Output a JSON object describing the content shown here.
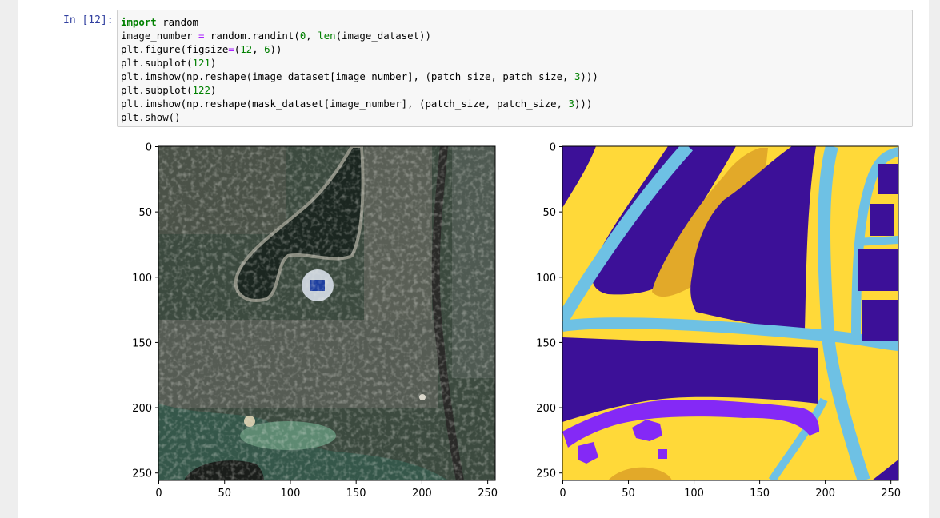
{
  "cell": {
    "prompt": "In [12]:",
    "code_lines": [
      [
        {
          "t": "import",
          "c": "kw"
        },
        {
          "t": " random",
          "c": ""
        }
      ],
      [
        {
          "t": "image_number ",
          "c": ""
        },
        {
          "t": "=",
          "c": "op"
        },
        {
          "t": " random.randint(",
          "c": ""
        },
        {
          "t": "0",
          "c": "num"
        },
        {
          "t": ", ",
          "c": ""
        },
        {
          "t": "len",
          "c": "bi"
        },
        {
          "t": "(image_dataset))",
          "c": ""
        }
      ],
      [
        {
          "t": "plt.figure(figsize",
          "c": ""
        },
        {
          "t": "=",
          "c": "op"
        },
        {
          "t": "(",
          "c": ""
        },
        {
          "t": "12",
          "c": "num"
        },
        {
          "t": ", ",
          "c": ""
        },
        {
          "t": "6",
          "c": "num"
        },
        {
          "t": "))",
          "c": ""
        }
      ],
      [
        {
          "t": "plt.subplot(",
          "c": ""
        },
        {
          "t": "121",
          "c": "num"
        },
        {
          "t": ")",
          "c": ""
        }
      ],
      [
        {
          "t": "plt.imshow(np.reshape(image_dataset[image_number], (patch_size, patch_size, ",
          "c": ""
        },
        {
          "t": "3",
          "c": "num"
        },
        {
          "t": ")))",
          "c": ""
        }
      ],
      [
        {
          "t": "plt.subplot(",
          "c": ""
        },
        {
          "t": "122",
          "c": "num"
        },
        {
          "t": ")",
          "c": ""
        }
      ],
      [
        {
          "t": "plt.imshow(np.reshape(mask_dataset[image_number], (patch_size, patch_size, ",
          "c": ""
        },
        {
          "t": "3",
          "c": "num"
        },
        {
          "t": ")))",
          "c": ""
        }
      ],
      [
        {
          "t": "plt.show()",
          "c": ""
        }
      ]
    ]
  },
  "plots": [
    {
      "kind": "satellite-image",
      "xticks": [
        "0",
        "50",
        "100",
        "150",
        "200",
        "250"
      ],
      "yticks": [
        "0",
        "50",
        "100",
        "150",
        "200",
        "250"
      ]
    },
    {
      "kind": "segmentation-mask",
      "xticks": [
        "0",
        "50",
        "100",
        "150",
        "200",
        "250"
      ],
      "yticks": [
        "0",
        "50",
        "100",
        "150",
        "200",
        "250"
      ]
    }
  ],
  "colors": {
    "mask_background": "#ffd939",
    "mask_building": "#3c1098",
    "mask_land": "#e2a929",
    "mask_road": "#6ec1e4",
    "mask_vegetation": "#8429f6",
    "prompt": "#303f9f"
  }
}
